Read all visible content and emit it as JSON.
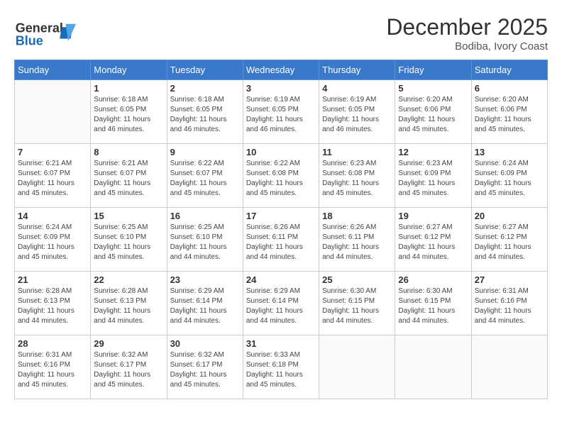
{
  "header": {
    "logo_general": "General",
    "logo_blue": "Blue",
    "month_title": "December 2025",
    "location": "Bodiba, Ivory Coast"
  },
  "days_of_week": [
    "Sunday",
    "Monday",
    "Tuesday",
    "Wednesday",
    "Thursday",
    "Friday",
    "Saturday"
  ],
  "weeks": [
    [
      {
        "day": "",
        "info": ""
      },
      {
        "day": "1",
        "info": "Sunrise: 6:18 AM\nSunset: 6:05 PM\nDaylight: 11 hours and 46 minutes."
      },
      {
        "day": "2",
        "info": "Sunrise: 6:18 AM\nSunset: 6:05 PM\nDaylight: 11 hours and 46 minutes."
      },
      {
        "day": "3",
        "info": "Sunrise: 6:19 AM\nSunset: 6:05 PM\nDaylight: 11 hours and 46 minutes."
      },
      {
        "day": "4",
        "info": "Sunrise: 6:19 AM\nSunset: 6:05 PM\nDaylight: 11 hours and 46 minutes."
      },
      {
        "day": "5",
        "info": "Sunrise: 6:20 AM\nSunset: 6:06 PM\nDaylight: 11 hours and 45 minutes."
      },
      {
        "day": "6",
        "info": "Sunrise: 6:20 AM\nSunset: 6:06 PM\nDaylight: 11 hours and 45 minutes."
      }
    ],
    [
      {
        "day": "7",
        "info": "Sunrise: 6:21 AM\nSunset: 6:07 PM\nDaylight: 11 hours and 45 minutes."
      },
      {
        "day": "8",
        "info": "Sunrise: 6:21 AM\nSunset: 6:07 PM\nDaylight: 11 hours and 45 minutes."
      },
      {
        "day": "9",
        "info": "Sunrise: 6:22 AM\nSunset: 6:07 PM\nDaylight: 11 hours and 45 minutes."
      },
      {
        "day": "10",
        "info": "Sunrise: 6:22 AM\nSunset: 6:08 PM\nDaylight: 11 hours and 45 minutes."
      },
      {
        "day": "11",
        "info": "Sunrise: 6:23 AM\nSunset: 6:08 PM\nDaylight: 11 hours and 45 minutes."
      },
      {
        "day": "12",
        "info": "Sunrise: 6:23 AM\nSunset: 6:09 PM\nDaylight: 11 hours and 45 minutes."
      },
      {
        "day": "13",
        "info": "Sunrise: 6:24 AM\nSunset: 6:09 PM\nDaylight: 11 hours and 45 minutes."
      }
    ],
    [
      {
        "day": "14",
        "info": "Sunrise: 6:24 AM\nSunset: 6:09 PM\nDaylight: 11 hours and 45 minutes."
      },
      {
        "day": "15",
        "info": "Sunrise: 6:25 AM\nSunset: 6:10 PM\nDaylight: 11 hours and 45 minutes."
      },
      {
        "day": "16",
        "info": "Sunrise: 6:25 AM\nSunset: 6:10 PM\nDaylight: 11 hours and 44 minutes."
      },
      {
        "day": "17",
        "info": "Sunrise: 6:26 AM\nSunset: 6:11 PM\nDaylight: 11 hours and 44 minutes."
      },
      {
        "day": "18",
        "info": "Sunrise: 6:26 AM\nSunset: 6:11 PM\nDaylight: 11 hours and 44 minutes."
      },
      {
        "day": "19",
        "info": "Sunrise: 6:27 AM\nSunset: 6:12 PM\nDaylight: 11 hours and 44 minutes."
      },
      {
        "day": "20",
        "info": "Sunrise: 6:27 AM\nSunset: 6:12 PM\nDaylight: 11 hours and 44 minutes."
      }
    ],
    [
      {
        "day": "21",
        "info": "Sunrise: 6:28 AM\nSunset: 6:13 PM\nDaylight: 11 hours and 44 minutes."
      },
      {
        "day": "22",
        "info": "Sunrise: 6:28 AM\nSunset: 6:13 PM\nDaylight: 11 hours and 44 minutes."
      },
      {
        "day": "23",
        "info": "Sunrise: 6:29 AM\nSunset: 6:14 PM\nDaylight: 11 hours and 44 minutes."
      },
      {
        "day": "24",
        "info": "Sunrise: 6:29 AM\nSunset: 6:14 PM\nDaylight: 11 hours and 44 minutes."
      },
      {
        "day": "25",
        "info": "Sunrise: 6:30 AM\nSunset: 6:15 PM\nDaylight: 11 hours and 44 minutes."
      },
      {
        "day": "26",
        "info": "Sunrise: 6:30 AM\nSunset: 6:15 PM\nDaylight: 11 hours and 44 minutes."
      },
      {
        "day": "27",
        "info": "Sunrise: 6:31 AM\nSunset: 6:16 PM\nDaylight: 11 hours and 44 minutes."
      }
    ],
    [
      {
        "day": "28",
        "info": "Sunrise: 6:31 AM\nSunset: 6:16 PM\nDaylight: 11 hours and 45 minutes."
      },
      {
        "day": "29",
        "info": "Sunrise: 6:32 AM\nSunset: 6:17 PM\nDaylight: 11 hours and 45 minutes."
      },
      {
        "day": "30",
        "info": "Sunrise: 6:32 AM\nSunset: 6:17 PM\nDaylight: 11 hours and 45 minutes."
      },
      {
        "day": "31",
        "info": "Sunrise: 6:33 AM\nSunset: 6:18 PM\nDaylight: 11 hours and 45 minutes."
      },
      {
        "day": "",
        "info": ""
      },
      {
        "day": "",
        "info": ""
      },
      {
        "day": "",
        "info": ""
      }
    ]
  ]
}
